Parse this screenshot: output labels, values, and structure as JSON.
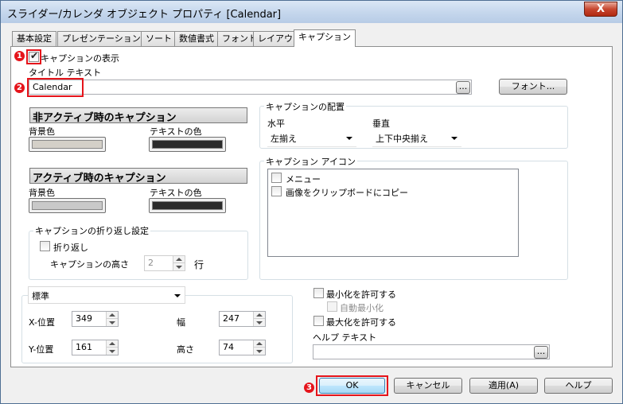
{
  "window": {
    "title": "スライダー/カレンダ オブジェクト プロパティ [Calendar]",
    "close_label": "X"
  },
  "tabs": [
    {
      "label": "基本設定"
    },
    {
      "label": "プレゼンテーション"
    },
    {
      "label": "ソート"
    },
    {
      "label": "数値書式"
    },
    {
      "label": "フォント"
    },
    {
      "label": "レイアウト"
    },
    {
      "label": "キャプション"
    }
  ],
  "caption": {
    "show_label": "キャプションの表示",
    "show_checked": true,
    "title_text_label": "タイトル テキスト",
    "title_text_value": "Calendar",
    "browse_label": "...",
    "font_button": "フォント..."
  },
  "inactive": {
    "header": "非アクティブ時のキャプション",
    "bg_label": "背景色",
    "text_label": "テキストの色",
    "bg_color": "#d4d0c8",
    "text_color": "#2b2b2b"
  },
  "active": {
    "header": "アクティブ時のキャプション",
    "bg_label": "背景色",
    "text_label": "テキストの色",
    "bg_color": "#c9c9c9",
    "text_color": "#2b2b2b"
  },
  "wrap": {
    "group_label": "キャプションの折り返し設定",
    "wrap_label": "折り返し",
    "height_label": "キャプションの高さ",
    "height_value": "2",
    "unit": "行"
  },
  "placement": {
    "group_label": "キャプションの配置",
    "horizontal_label": "水平",
    "horizontal_value": "左揃え",
    "vertical_label": "垂直",
    "vertical_value": "上下中央揃え"
  },
  "icons": {
    "group_label": "キャプション アイコン",
    "items": [
      {
        "label": "メニュー"
      },
      {
        "label": "画像をクリップボードにコピー"
      }
    ]
  },
  "position": {
    "mode_value": "標準",
    "x_label": "X-位置",
    "x_value": "349",
    "w_label": "幅",
    "w_value": "247",
    "y_label": "Y-位置",
    "y_value": "161",
    "h_label": "高さ",
    "h_value": "74"
  },
  "window_opts": {
    "minimize_label": "最小化を許可する",
    "auto_minimize_label": "自動最小化",
    "maximize_label": "最大化を許可する",
    "help_text_label": "ヘルプ テキスト",
    "browse_label": "..."
  },
  "buttons": {
    "ok": "OK",
    "cancel": "キャンセル",
    "apply": "適用(A)",
    "help": "ヘルプ"
  },
  "markers": {
    "m1": "1",
    "m2": "2",
    "m3": "3"
  },
  "colors": {
    "accent_red": "#e5141b"
  }
}
